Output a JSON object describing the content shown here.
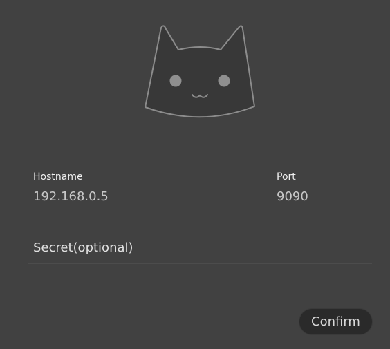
{
  "logo": {
    "icon": "cat-face-icon",
    "colors": {
      "fill": "#383838",
      "stroke": "#8c8c8c",
      "eyes": "#8f8f8f"
    }
  },
  "form": {
    "hostname": {
      "label": "Hostname",
      "value": "192.168.0.5"
    },
    "port": {
      "label": "Port",
      "value": "9090"
    },
    "secret": {
      "placeholder": "Secret(optional)",
      "value": ""
    }
  },
  "actions": {
    "confirm_label": "Confirm"
  },
  "colors": {
    "background": "#414141",
    "button_background": "#2a2a2a",
    "divider": "#4c4c4c"
  }
}
